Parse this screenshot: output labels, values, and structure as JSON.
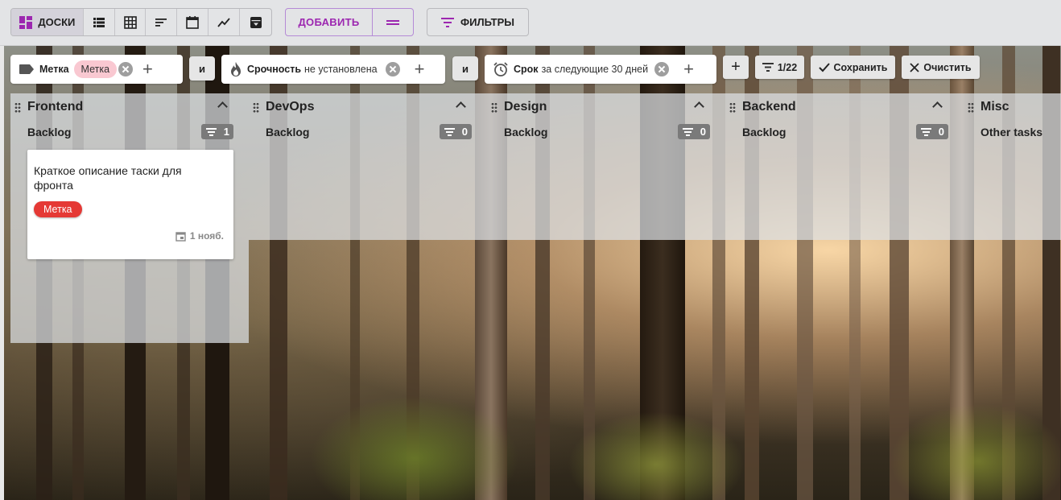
{
  "toolbar": {
    "boards_label": "ДОСКИ",
    "view_buttons": [
      "list-view-icon",
      "table-view-icon",
      "sort-view-icon",
      "calendar-view-icon",
      "chart-view-icon",
      "archive-icon"
    ],
    "add_label": "ДОБАВИТЬ",
    "filters_label": "ФИЛЬТРЫ",
    "accent_color": "#9c27b0"
  },
  "filters": {
    "label_filter": {
      "name": "Метка",
      "value": "Метка"
    },
    "and1": "и",
    "urgency_filter": {
      "name": "Срочность",
      "value": "не установлена"
    },
    "and2": "и",
    "due_filter": {
      "name": "Срок",
      "value": "за следующие 30 дней"
    },
    "add_symbol": "+",
    "counter": "1/22",
    "save_label": "Сохранить",
    "clear_label": "Очистить"
  },
  "lanes": [
    {
      "title": "Frontend",
      "column": "Backlog",
      "count": "1"
    },
    {
      "title": "DevOps",
      "column": "Backlog",
      "count": "0"
    },
    {
      "title": "Design",
      "column": "Backlog",
      "count": "0"
    },
    {
      "title": "Backend",
      "column": "Backlog",
      "count": "0"
    },
    {
      "title": "Misc",
      "column": "Other tasks"
    }
  ],
  "card": {
    "title": "Краткое описание таски для фронта",
    "label": "Метка",
    "label_color": "#e53935",
    "date": "1 нояб."
  }
}
